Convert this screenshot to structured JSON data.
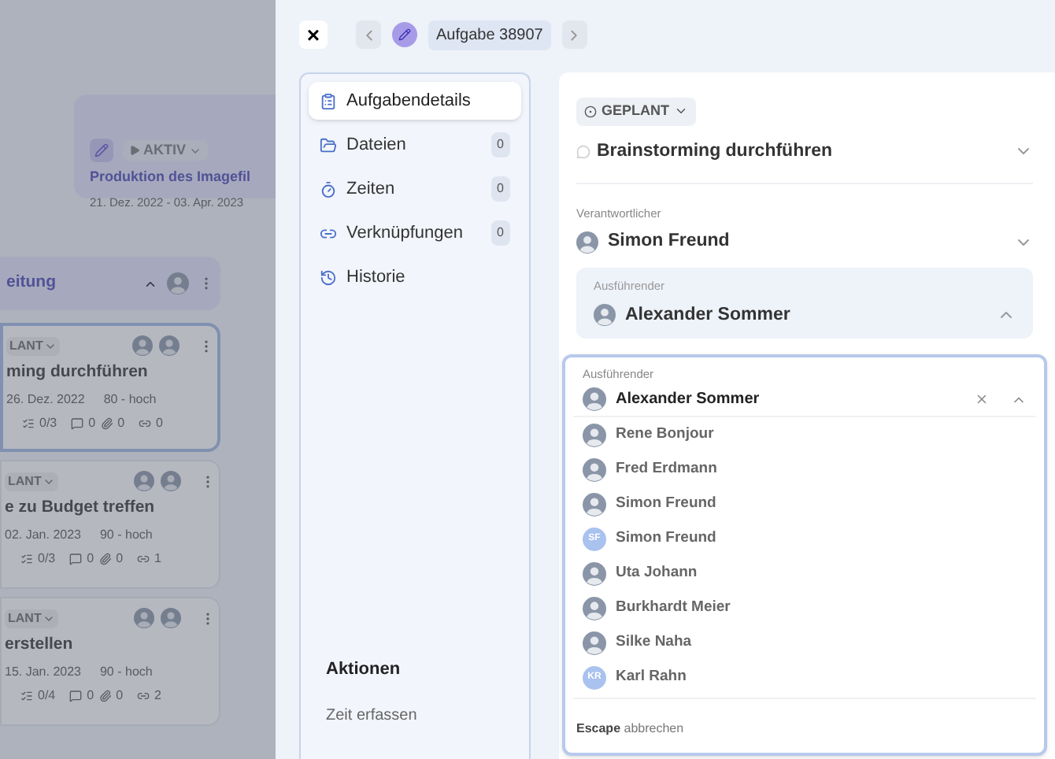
{
  "board": {
    "project": {
      "status": "AKTIV",
      "title": "Produktion des Imagefil",
      "dates": "21. Dez. 2022 - 03. Apr. 2023"
    },
    "column": {
      "title": "eitung",
      "expanded": true
    },
    "cards": [
      {
        "status": "LANT",
        "title": "ming durchführen",
        "date": "26. Dez. 2022",
        "priority": "80 - hoch",
        "checklist": "0/3",
        "comments": "0",
        "attachments": "0",
        "links": "0",
        "selected": true
      },
      {
        "status": "LANT",
        "title": "e zu Budget treffen",
        "date": "02. Jan. 2023",
        "priority": "90 - hoch",
        "checklist": "0/3",
        "comments": "0",
        "attachments": "0",
        "links": "1",
        "selected": false
      },
      {
        "status": "LANT",
        "title": "erstellen",
        "date": "15. Jan. 2023",
        "priority": "90 - hoch",
        "checklist": "0/4",
        "comments": "0",
        "attachments": "0",
        "links": "2",
        "selected": false
      }
    ]
  },
  "header": {
    "close": "×",
    "title": "Aufgabe 38907"
  },
  "nav": {
    "items": [
      {
        "kind": "details",
        "label": "Aufgabendetails",
        "selected": true
      },
      {
        "kind": "files",
        "label": "Dateien",
        "count": "0",
        "selected": false
      },
      {
        "kind": "time",
        "label": "Zeiten",
        "count": "0",
        "selected": false
      },
      {
        "kind": "links",
        "label": "Verknüpfungen",
        "count": "0",
        "selected": false
      },
      {
        "kind": "history",
        "label": "Historie",
        "selected": false
      }
    ],
    "actions_title": "Aktionen",
    "actions": [
      "Zeit erfassen"
    ]
  },
  "task": {
    "status": "GEPLANT",
    "title": "Brainstorming durchführen",
    "responsible": {
      "label": "Verantwortlicher",
      "name": "Simon Freund"
    },
    "executor": {
      "label": "Ausführender",
      "name": "Alexander Sommer",
      "expanded": true
    }
  },
  "dropdown": {
    "label": "Ausführender",
    "value": "Alexander Sommer",
    "options": [
      {
        "name": "Rene Bonjour",
        "kind": "photo"
      },
      {
        "name": "Fred Erdmann",
        "kind": "photo"
      },
      {
        "name": "Simon Freund",
        "kind": "photo"
      },
      {
        "name": "Simon Freund",
        "kind": "initials",
        "initials": "SF"
      },
      {
        "name": "Uta Johann",
        "kind": "photo"
      },
      {
        "name": "Burkhardt Meier",
        "kind": "photo"
      },
      {
        "name": "Silke Naha",
        "kind": "photo"
      },
      {
        "name": "Karl Rahn",
        "kind": "initials",
        "initials": "KR"
      }
    ],
    "hint_key": "Escape",
    "hint": "abbrechen"
  }
}
